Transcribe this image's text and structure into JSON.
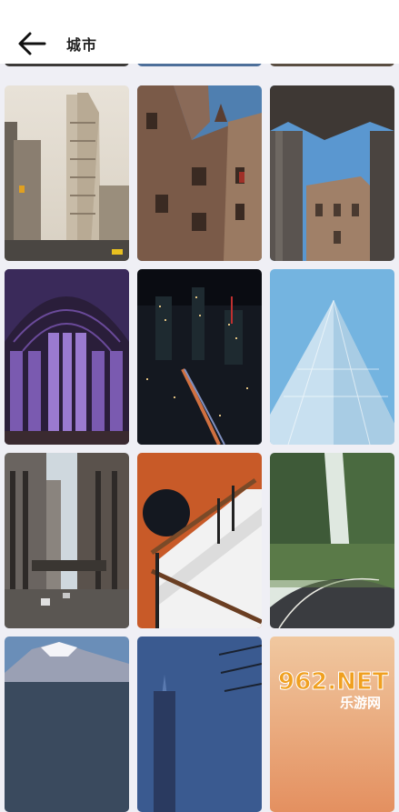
{
  "header": {
    "title": "城市",
    "back_icon": "arrow-left-icon"
  },
  "gallery": {
    "photos": [
      {
        "subject": "flatiron-building"
      },
      {
        "subject": "medieval-castle-facade"
      },
      {
        "subject": "stone-tower-with-columns"
      },
      {
        "subject": "gothic-chapel-stained-glass"
      },
      {
        "subject": "city-skyline-at-night"
      },
      {
        "subject": "glass-pyramid-building"
      },
      {
        "subject": "street-with-skyscrapers"
      },
      {
        "subject": "orange-staircase"
      },
      {
        "subject": "forest-road"
      },
      {
        "subject": "snowy-mountain"
      },
      {
        "subject": "tower-at-dusk"
      },
      {
        "subject": "sunset-sky"
      }
    ]
  },
  "watermark": {
    "main": "962.NET",
    "sub": "乐游网"
  },
  "colors": {
    "header_bg": "#ffffff",
    "page_bg": "#efeff5",
    "watermark_accent": "#f0a020"
  }
}
